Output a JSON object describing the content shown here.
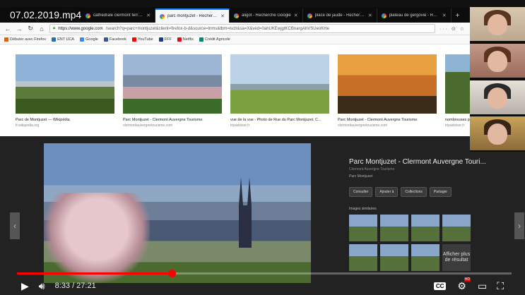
{
  "video": {
    "title": "07.02.2019.mp4",
    "current_time": "8:33",
    "duration": "27:21",
    "time_text": "8:33 / 27:21",
    "progress": 0.313,
    "accent": "#ff0000"
  },
  "browser": {
    "tabs": [
      {
        "label": "cathédrale clermont ferrand",
        "active": false,
        "icon": "google-icon"
      },
      {
        "label": "parc montjuzet - Recherche G",
        "active": true,
        "icon": "google-icon"
      },
      {
        "label": "aligot - Recherche Google",
        "active": false,
        "icon": "google-icon"
      },
      {
        "label": "place de jaude - Recherche G",
        "active": false,
        "icon": "google-icon"
      },
      {
        "label": "plateau de gergovie - Rech",
        "active": false,
        "icon": "google-icon"
      }
    ],
    "new_tab": "+",
    "url_host": "https://www.google.com",
    "url_path": "/search?q=parc+montjuzet&client=firefox-b-d&source=lnms&tbm=isch&sa=X&ved=0ahUKEwjgtKCBnargAhVSUeoKHe",
    "url_menu": "··· ⊙ ☆",
    "bookmarks": [
      {
        "label": "Débuter avec Firefox",
        "color": "#e66000"
      },
      {
        "label": "ENT UCA",
        "color": "#2a6db5"
      },
      {
        "label": "Google",
        "color": "#4285f4"
      },
      {
        "label": "Facebook",
        "color": "#3b5998"
      },
      {
        "label": "YouTube",
        "color": "#ff0000"
      },
      {
        "label": "FFF",
        "color": "#1a3a8a"
      },
      {
        "label": "Netflix",
        "color": "#e50914"
      },
      {
        "label": "Crédit Agricole",
        "color": "#008a6a"
      }
    ]
  },
  "results": [
    {
      "caption": "Parc de Montjuzet — Wikipédia",
      "source": "fr.wikipedia.org"
    },
    {
      "caption": "Parc Montjuzet - Clermont Auvergne Tourisme",
      "source": "clermontauvergnetourisme.com"
    },
    {
      "caption": "vue de la vue - Photo de Rue du Parc Montjuzet, C...",
      "source": "tripadvisor.fr"
    },
    {
      "caption": "Parc Montjuzet - Clermont Auvergne Tourisme",
      "source": "clermontauvergnetourisme.com"
    },
    {
      "caption": "nombreuses promena",
      "source": "tripadvisor.fr"
    }
  ],
  "preview": {
    "title": "Parc Montjuzet - Clermont Auvergne Touri...",
    "source": "Clermont Auvergne Tourisme",
    "subtitle": "Parc Montjuzet",
    "actions": [
      "Consulter",
      "Ajouter à",
      "Collections",
      "Partager"
    ],
    "similar_label": "Images similaires",
    "more_label": "Afficher plus de résultat"
  },
  "controls": {
    "play_icon": "play-icon",
    "volume_icon": "volume-icon",
    "cc_label": "CC",
    "hd_badge": "HD"
  }
}
